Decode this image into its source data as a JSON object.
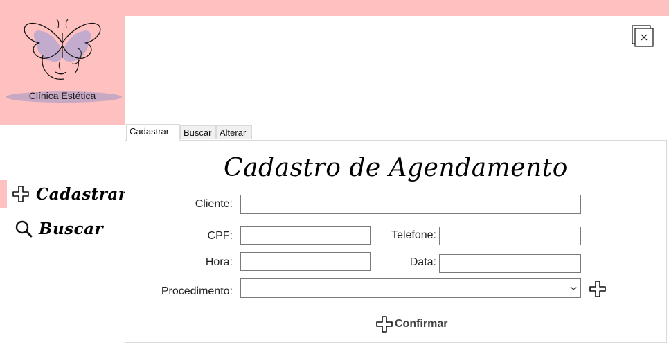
{
  "logo": {
    "caption": "Clínica Estética"
  },
  "window": {
    "close_icon": "close-window-icon"
  },
  "sidebar": {
    "items": [
      {
        "label": "Cadastrar",
        "icon": "plus-icon",
        "active": true
      },
      {
        "label": "Buscar",
        "icon": "search-icon",
        "active": false
      }
    ]
  },
  "tabs": [
    {
      "label": "Cadastrar",
      "active": true
    },
    {
      "label": "Buscar",
      "active": false
    },
    {
      "label": "Alterar",
      "active": false
    }
  ],
  "form": {
    "title": "Cadastro de Agendamento",
    "cliente_label": "Cliente:",
    "cliente_value": "",
    "cpf_label": "CPF:",
    "cpf_value": "",
    "telefone_label": "Telefone:",
    "telefone_value": "",
    "hora_label": "Hora:",
    "hora_value": "",
    "data_label": "Data:",
    "data_value": "",
    "procedimento_label": "Procedimento:",
    "procedimento_value": "",
    "confirm_label": "Confirmar"
  },
  "colors": {
    "accent": "#ffc0c0",
    "border": "#7a7a7a",
    "panel_border": "#d9d9d9"
  }
}
